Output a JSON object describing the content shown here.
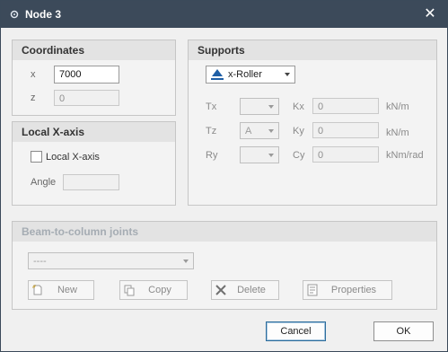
{
  "window": {
    "title": "Node 3",
    "close_glyph": "✕"
  },
  "coordinates": {
    "header": "Coordinates",
    "x_label": "x",
    "x_value": "7000",
    "z_label": "z",
    "z_value": "0"
  },
  "local_axis": {
    "header": "Local X-axis",
    "checkbox_label": "Local X-axis",
    "checked": false,
    "angle_label": "Angle",
    "angle_value": ""
  },
  "supports": {
    "header": "Supports",
    "support_type": "x-Roller",
    "rows": [
      {
        "dof": "Tx",
        "dof_value": "",
        "spring": "Kx",
        "spring_value": "0",
        "unit": "kN/m"
      },
      {
        "dof": "Tz",
        "dof_value": "A",
        "spring": "Ky",
        "spring_value": "0",
        "unit": "kN/m"
      },
      {
        "dof": "Ry",
        "dof_value": "",
        "spring": "Cy",
        "spring_value": "0",
        "unit": "kNm/rad"
      }
    ]
  },
  "joints": {
    "header": "Beam-to-column joints",
    "select_value": "----",
    "buttons": {
      "new": "New",
      "copy": "Copy",
      "delete": "Delete",
      "properties": "Properties"
    }
  },
  "footer": {
    "cancel": "Cancel",
    "ok": "OK"
  },
  "colors": {
    "titlebar": "#3c4a5a",
    "accent": "#2d6d9c",
    "support_icon": "#1f5fa6"
  }
}
